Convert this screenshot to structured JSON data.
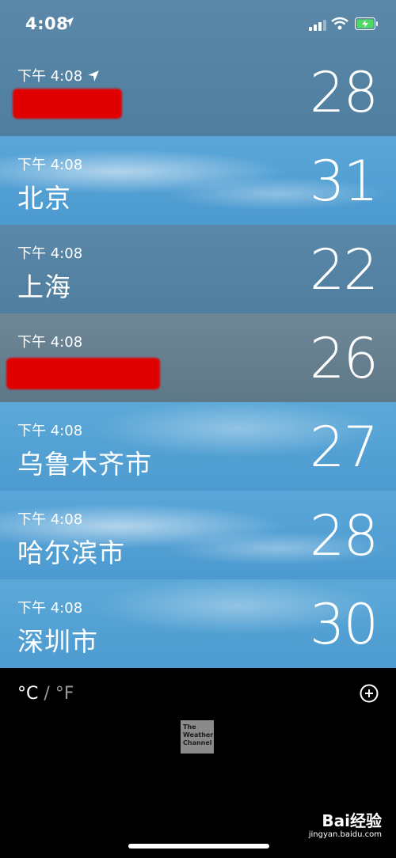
{
  "status_bar": {
    "time": "4:08",
    "icons": [
      "location-arrow-icon",
      "signal-icon",
      "wifi-icon",
      "battery-charging-icon"
    ]
  },
  "cities": [
    {
      "time": "下午 4:08",
      "name": "",
      "temp": "28",
      "current_location": true,
      "redacted": true
    },
    {
      "time": "下午 4:08",
      "name": "北京",
      "temp": "31"
    },
    {
      "time": "下午 4:08",
      "name": "上海",
      "temp": "22"
    },
    {
      "time": "下午 4:08",
      "name": "",
      "temp": "26",
      "redacted": true
    },
    {
      "time": "下午 4:08",
      "name": "乌鲁木齐市",
      "temp": "27"
    },
    {
      "time": "下午 4:08",
      "name": "哈尔滨市",
      "temp": "28"
    },
    {
      "time": "下午 4:08",
      "name": "深圳市",
      "temp": "30"
    }
  ],
  "footer": {
    "unit_c": "°C",
    "unit_sep": "/",
    "unit_f": "°F",
    "logo_text": "The Weather Channel",
    "add_icon": "plus-circle-icon",
    "watermark": "Bai经验",
    "watermark_sub": "jingyan.baidu.com"
  },
  "colors": {
    "rain": "#5b88a8",
    "rain_dark": "#6f8796",
    "sunny": "#5aa6d8",
    "redaction": "#e00000"
  }
}
